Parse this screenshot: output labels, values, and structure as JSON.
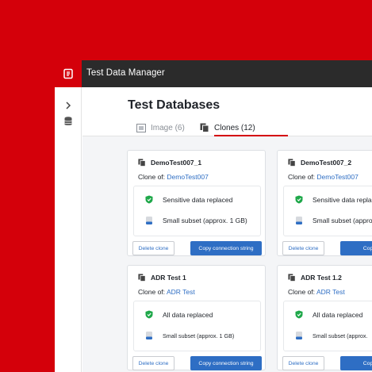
{
  "app": {
    "title": "Test Data Manager"
  },
  "page": {
    "title": "Test Databases"
  },
  "tabs": [
    {
      "label": "Image (6)"
    },
    {
      "label": "Clones (12)"
    }
  ],
  "cards": [
    {
      "name": "DemoTest007_1",
      "clone_of_label": "Clone of:",
      "clone_of": "DemoTest007",
      "feature1": "Sensitive data replaced",
      "feature2": "Small subset (approx. 1 GB)",
      "delete_label": "Delete clone",
      "copy_label": "Copy connection string"
    },
    {
      "name": "DemoTest007_2",
      "clone_of_label": "Clone of:",
      "clone_of": "DemoTest007",
      "feature1": "Sensitive data repla",
      "feature2": "Small subset (appro",
      "delete_label": "Delete clone",
      "copy_label": "Copy conn"
    },
    {
      "name": "ADR Test 1",
      "clone_of_label": "Clone of:",
      "clone_of": "ADR Test",
      "feature1": "All data replaced",
      "feature2": "Small subset (approx. 1 GB)",
      "delete_label": "Delete clone",
      "copy_label": "Copy connection string"
    },
    {
      "name": "ADR Test 1.2",
      "clone_of_label": "Clone of:",
      "clone_of": "ADR Test",
      "feature1": "All data replaced",
      "feature2": "Small subset (approx.",
      "delete_label": "Delete clone",
      "copy_label": "Copy conn"
    }
  ],
  "icons": {
    "logo": "redgate-logo-icon",
    "expand": "chevron-right-icon",
    "database": "database-icon",
    "image_tab": "image-icon",
    "clones_tab": "copy-icon",
    "clone_card": "copy-icon",
    "shield": "shield-check-icon",
    "db_small": "database-small-icon"
  },
  "colors": {
    "brand_red": "#d4000a",
    "topbar": "#2b2b2b",
    "primary_blue": "#2e6ec4",
    "check_green": "#1fa84a"
  }
}
